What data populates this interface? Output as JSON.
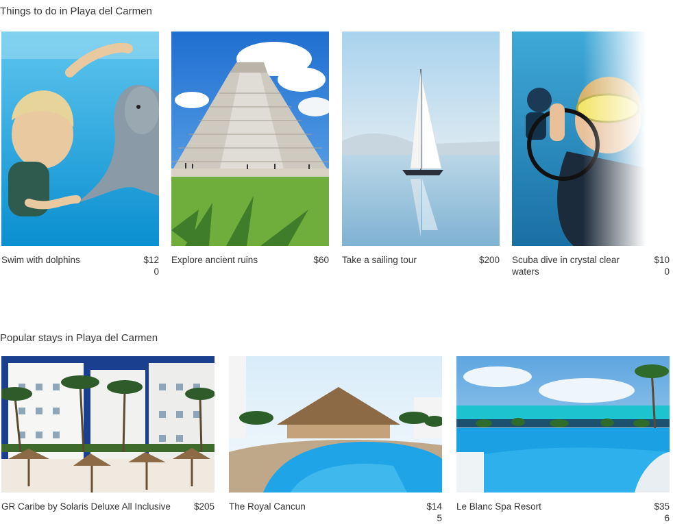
{
  "things_section": {
    "title": "Things to do in Playa del Carmen",
    "items": [
      {
        "name": "Swim with dolphins",
        "price": "$120",
        "image_icon": "dolphin-swim-photo"
      },
      {
        "name": "Explore ancient ruins",
        "price": "$60",
        "image_icon": "pyramid-photo"
      },
      {
        "name": "Take a sailing tour",
        "price": "$200",
        "image_icon": "sailboat-photo"
      },
      {
        "name": "Scuba dive in crystal clear waters",
        "price": "$100",
        "image_icon": "scuba-diver-photo"
      }
    ]
  },
  "stays_section": {
    "title": "Popular stays in Playa del Carmen",
    "items": [
      {
        "name": "GR Caribe by Solaris Deluxe All Inclusive",
        "price": "$205",
        "image_icon": "hotel-beach-photo"
      },
      {
        "name": "The Royal Cancun",
        "price": "$145",
        "image_icon": "resort-pool-photo"
      },
      {
        "name": "Le Blanc Spa Resort",
        "price": "$356",
        "image_icon": "infinity-pool-photo"
      }
    ]
  },
  "colors": {
    "text": "#333333",
    "sea": "#1aa7e0",
    "sky": "#8fc3e6"
  }
}
